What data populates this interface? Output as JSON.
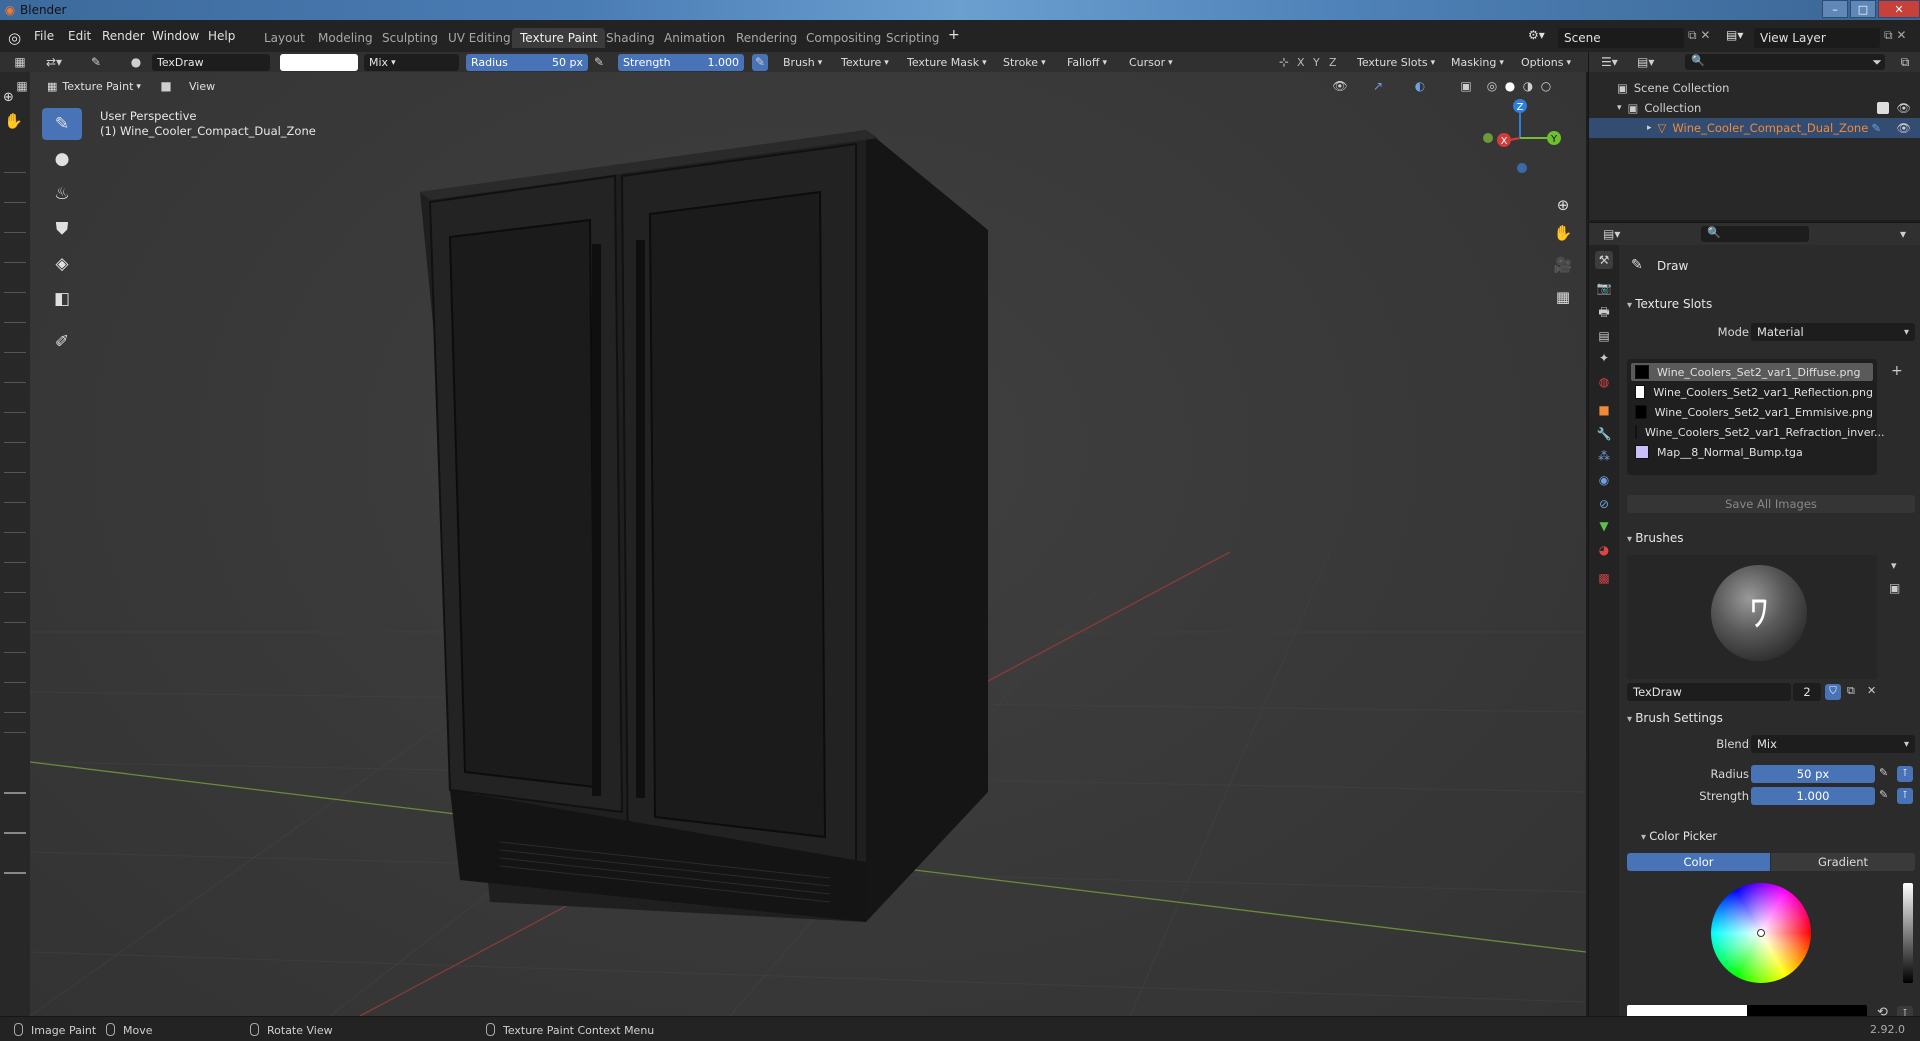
{
  "window": {
    "title": "Blender"
  },
  "menu": {
    "items": [
      "File",
      "Edit",
      "Render",
      "Window",
      "Help"
    ]
  },
  "workspaces": [
    "Layout",
    "Modeling",
    "Sculpting",
    "UV Editing",
    "Texture Paint",
    "Shading",
    "Animation",
    "Rendering",
    "Compositing",
    "Scripting"
  ],
  "active_workspace": "Texture Paint",
  "scene": {
    "label": "Scene",
    "view_layer": "View Layer"
  },
  "tool_header": {
    "brush_name": "TexDraw",
    "blend": "Mix",
    "radius_label": "Radius",
    "radius_value": "50 px",
    "strength_label": "Strength",
    "strength_value": "1.000",
    "menus": [
      "Brush",
      "Texture",
      "Texture Mask",
      "Stroke",
      "Falloff",
      "Cursor"
    ],
    "axes": [
      "X",
      "Y",
      "Z"
    ],
    "texture_slots": "Texture Slots",
    "masking": "Masking",
    "options": "Options"
  },
  "viewport_header": {
    "mode": "Texture Paint",
    "view_menu": "View"
  },
  "viewport": {
    "perspective": "User Perspective",
    "object_label": "(1) Wine_Cooler_Compact_Dual_Zone"
  },
  "gizmo": {
    "x": "X",
    "y": "Y",
    "z": "Z"
  },
  "outliner": {
    "scene_collection": "Scene Collection",
    "collection": "Collection",
    "object": "Wine_Cooler_Compact_Dual_Zone"
  },
  "properties": {
    "tool_name": "Draw",
    "texture_slots": {
      "title": "Texture Slots",
      "mode_label": "Mode",
      "mode_value": "Material",
      "slots": [
        {
          "name": "Wine_Coolers_Set2_var1_Diffuse.png",
          "color": "#000000"
        },
        {
          "name": "Wine_Coolers_Set2_var1_Reflection.png",
          "color": "#ffffff"
        },
        {
          "name": "Wine_Coolers_Set2_var1_Emmisive.png",
          "color": "#000000"
        },
        {
          "name": "Wine_Coolers_Set2_var1_Refraction_inver...",
          "color": "#f4f4f4"
        },
        {
          "name": "Map__8_Normal_Bump.tga",
          "color": "#c8c0f8"
        }
      ],
      "save_all": "Save All Images"
    },
    "brushes": {
      "title": "Brushes",
      "brush_name": "TexDraw",
      "users": "2"
    },
    "brush_settings": {
      "title": "Brush Settings",
      "blend_label": "Blend",
      "blend_value": "Mix",
      "radius_label": "Radius",
      "radius_value": "50 px",
      "strength_label": "Strength",
      "strength_value": "1.000"
    },
    "color_picker": {
      "title": "Color Picker",
      "tab_color": "Color",
      "tab_gradient": "Gradient"
    }
  },
  "statusbar": {
    "items": [
      "Image Paint",
      "Move",
      "Rotate View",
      "Texture Paint Context Menu"
    ],
    "version": "2.92.0"
  },
  "colors": {
    "accent": "#4873b6",
    "selection": "#334c71",
    "object_orange": "#f08a3a"
  }
}
